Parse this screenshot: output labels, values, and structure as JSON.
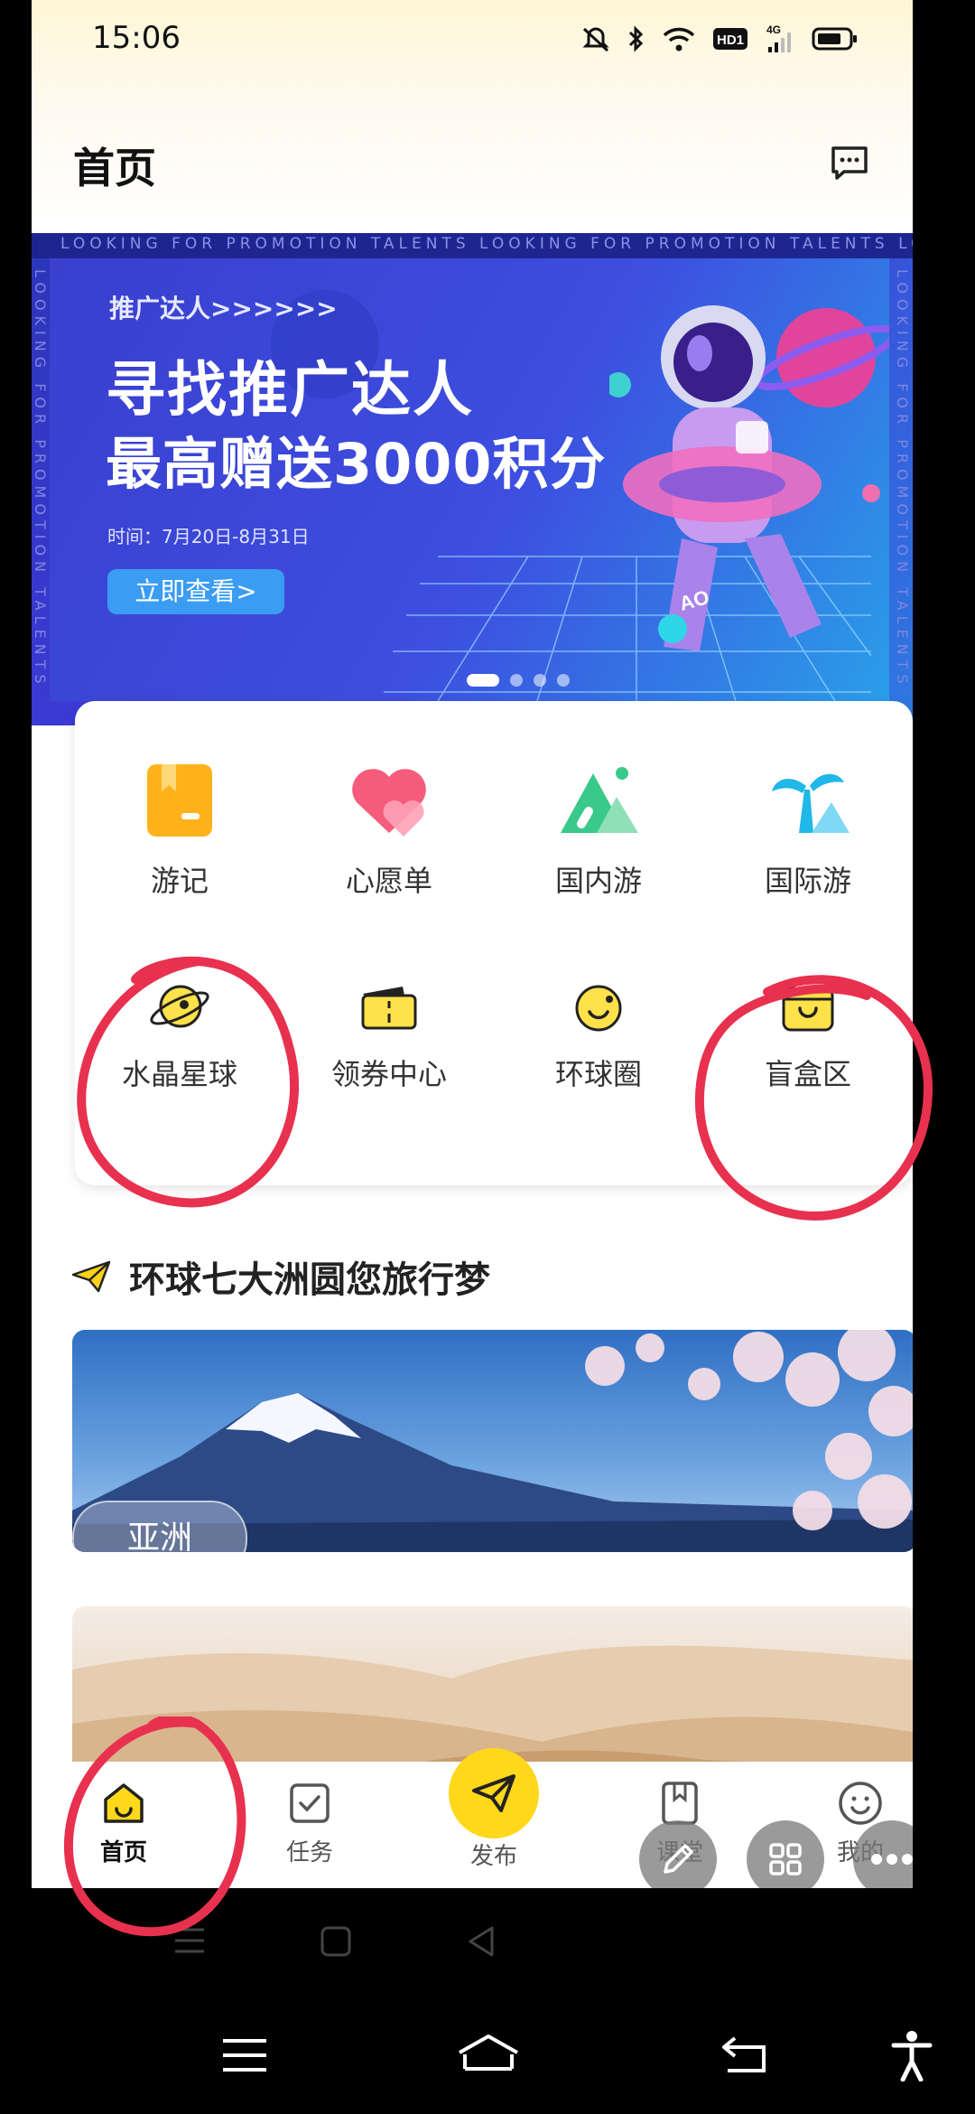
{
  "status_bar": {
    "time": "15:06",
    "network": "4G",
    "hd": "HD1"
  },
  "header": {
    "title": "首页"
  },
  "banner": {
    "ticker": "LOOKING FOR PROMOTION TALENTS   LOOKING FOR PROMOTION TALENTS   LOOKIN",
    "side_text": "LOOKING FOR PROMOTION TALENTS",
    "tag": "推广达人>>>>>>",
    "headline1": "寻找推广达人",
    "headline2": "最高赠送3000积分",
    "date": "时间：7月20日-8月31日",
    "cta": "立即查看>",
    "slides_total": 4,
    "slide_active": 1,
    "colors": {
      "bg": "#3a3fce",
      "cta": "#3a9cf2"
    }
  },
  "quick_menu": {
    "row1": [
      {
        "label": "游记",
        "icon": "notebook-icon"
      },
      {
        "label": "心愿单",
        "icon": "heart-icon"
      },
      {
        "label": "国内游",
        "icon": "mountain-icon"
      },
      {
        "label": "国际游",
        "icon": "palm-tree-icon"
      }
    ],
    "row2": [
      {
        "label": "水晶星球",
        "icon": "planet-icon"
      },
      {
        "label": "领券中心",
        "icon": "coupon-icon"
      },
      {
        "label": "环球圈",
        "icon": "globe-ring-icon"
      },
      {
        "label": "盲盒区",
        "icon": "blind-box-icon"
      }
    ]
  },
  "section": {
    "title": "环球七大洲圆您旅行梦"
  },
  "destinations": [
    {
      "label": "亚洲"
    }
  ],
  "tabbar": {
    "items": [
      {
        "label": "首页",
        "icon": "home-icon",
        "active": true
      },
      {
        "label": "任务",
        "icon": "task-icon",
        "active": false
      },
      {
        "label": "发布",
        "icon": "paper-plane-icon",
        "active": false
      },
      {
        "label": "课堂",
        "icon": "book-icon",
        "active": false
      },
      {
        "label": "我的",
        "icon": "smile-icon",
        "active": false
      }
    ],
    "accent": "#ffd81a"
  }
}
